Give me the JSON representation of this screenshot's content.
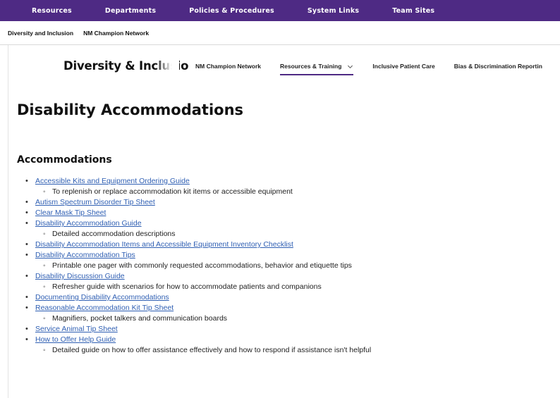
{
  "top_nav": [
    "Resources",
    "Departments",
    "Policies & Procedures",
    "System Links",
    "Team Sites"
  ],
  "breadcrumbs": [
    "Diversity and Inclusion",
    "NM Champion Network"
  ],
  "site": {
    "brand": "Diversity & Inclusio",
    "nav": [
      "NM Champion Network",
      "Resources & Training",
      "Inclusive Patient Care",
      "Bias & Discrimination Reportin"
    ],
    "active_nav": "Resources & Training"
  },
  "page": {
    "title": "Disability Accommodations",
    "section_title": "Accommodations",
    "items": [
      {
        "link": "Accessible Kits and Equipment Ordering Guide",
        "desc": "To replenish or replace accommodation kit items or accessible equipment"
      },
      {
        "link": "Autism Spectrum Disorder Tip Sheet",
        "desc": ""
      },
      {
        "link": "Clear Mask Tip Sheet",
        "desc": ""
      },
      {
        "link": "Disability Accommodation Guide",
        "desc": "Detailed accommodation descriptions"
      },
      {
        "link": "Disability Accommodation Items and Accessible Equipment Inventory Checklist",
        "desc": ""
      },
      {
        "link": "Disability Accommodation Tips",
        "desc": "Printable one pager with commonly requested accommodations, behavior and etiquette tips"
      },
      {
        "link": "Disability Discussion Guide",
        "desc": "Refresher guide with scenarios for how to accommodate patients and companions"
      },
      {
        "link": "Documenting Disability Accommodations",
        "desc": ""
      },
      {
        "link": "Reasonable Accommodation Kit Tip Sheet",
        "desc": "Magnifiers, pocket talkers and communication boards"
      },
      {
        "link": "Service Animal Tip Sheet",
        "desc": ""
      },
      {
        "link": "How to Offer Help Guide",
        "desc": "Detailed guide on how to offer assistance effectively and how to respond if assistance isn't helpful"
      }
    ]
  },
  "colors": {
    "brand_purple": "#4e2a84",
    "link_blue": "#2f5fb3"
  },
  "icons": {
    "dropdown": "chevron-down-icon"
  }
}
